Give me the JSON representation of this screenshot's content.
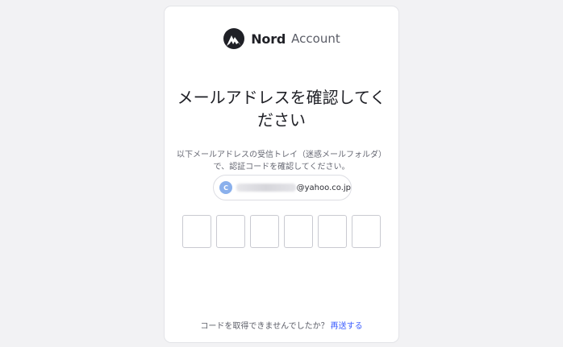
{
  "brand": {
    "name": "Nord",
    "suffix": "Account",
    "logo_icon": "nord-mountain-logo-icon"
  },
  "page": {
    "title_line1": "メールアドレスを確認してく",
    "title_line2": "ださい",
    "description_line1": "以下メールアドレスの受信トレイ（迷惑メールフォルダ）",
    "description_line2": "で、認証コードを確認してください。"
  },
  "email": {
    "avatar_letter": "C",
    "domain": "@yahoo.co.jp"
  },
  "code_inputs": [
    "",
    "",
    "",
    "",
    "",
    ""
  ],
  "resend": {
    "prompt": "コードを取得できませんでしたか？",
    "link_label": "再送する"
  },
  "colors": {
    "background": "#f2f2f4",
    "link": "#3e5fff",
    "avatar": "#8ab0ec"
  }
}
